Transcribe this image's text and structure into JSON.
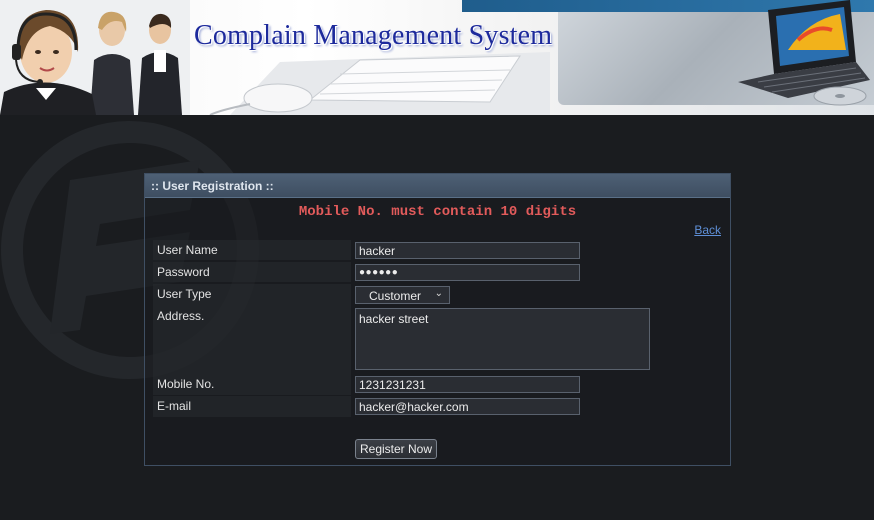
{
  "banner": {
    "title": "Complain Management System"
  },
  "panel": {
    "header": ":: User Registration ::",
    "error": "Mobile No. must contain 10 digits",
    "back_label": "Back"
  },
  "form": {
    "username": {
      "label": "User Name",
      "value": "hacker"
    },
    "password": {
      "label": "Password",
      "value": "●●●●●●"
    },
    "usertype": {
      "label": "User Type",
      "value": "Customer"
    },
    "address": {
      "label": "Address.",
      "value": "hacker street"
    },
    "mobile": {
      "label": "Mobile No.",
      "value": "1231231231"
    },
    "email": {
      "label": "E-mail",
      "value": "hacker@hacker.com"
    },
    "submit_label": "Register Now"
  },
  "colors": {
    "page_bg": "#1a1c1f",
    "error": "#e25b5b",
    "title": "#1d2a9c",
    "panel_header": "#4e6075",
    "link": "#5e8fd6"
  },
  "icons": [
    "chevron-down-icon",
    "headset-icon"
  ]
}
